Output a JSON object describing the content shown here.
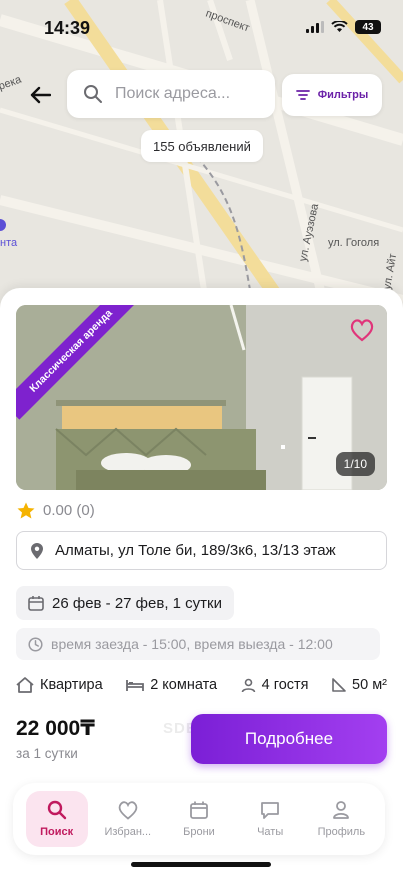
{
  "status_bar": {
    "time": "14:39",
    "battery": "43"
  },
  "map": {
    "streets": [
      "ул. Ауэзова",
      "ул. Гоголя",
      "ул. Айт",
      "проспект",
      "река",
      "нта"
    ]
  },
  "header": {
    "search_placeholder": "Поиск адреса...",
    "filters_label": "Фильтры",
    "listings_count": "155 объявлений"
  },
  "listing": {
    "badge": "Классическая аренда",
    "photo_counter": "1/10",
    "rating": "0.00 (0)",
    "address": "Алматы, ул Толе би, 189/3к6, 13/13 этаж",
    "dates": "26 фев - 27 фев, 1 сутки",
    "checkin_info": "время заезда - 15:00, время выезда - 12:00",
    "features": {
      "type": "Квартира",
      "rooms": "2 комната",
      "guests": "4 гостя",
      "area": "50 м²"
    },
    "price": "22 000₸",
    "price_period": "за 1 сутки",
    "watermark": "SDELKA.KZ",
    "details_button": "Подробнее"
  },
  "nav": {
    "items": [
      {
        "label": "Поиск",
        "icon": "search-icon"
      },
      {
        "label": "Избран...",
        "icon": "heart-icon"
      },
      {
        "label": "Брони",
        "icon": "calendar-icon"
      },
      {
        "label": "Чаты",
        "icon": "chat-icon"
      },
      {
        "label": "Профиль",
        "icon": "user-icon"
      }
    ]
  },
  "colors": {
    "accent": "#7e22ce",
    "active_nav": "#c01a5e",
    "star": "#f5b301"
  }
}
